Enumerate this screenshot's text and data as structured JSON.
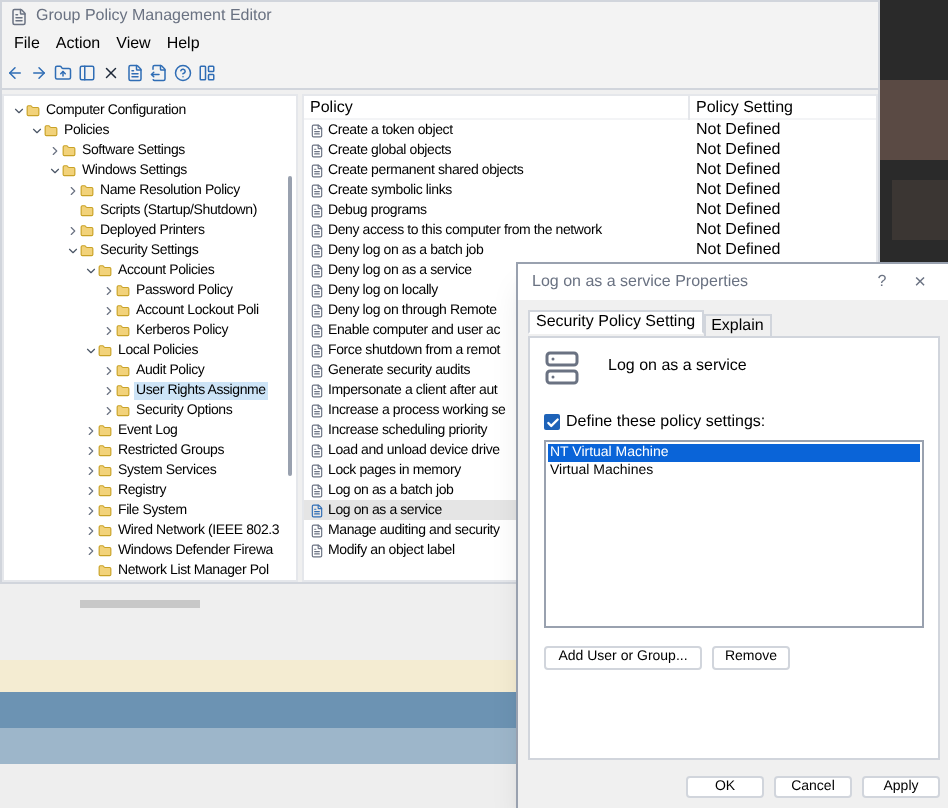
{
  "main_window": {
    "title": "Group Policy Management Editor",
    "menu": [
      "File",
      "Action",
      "View",
      "Help"
    ],
    "tree": [
      {
        "label": "Computer Configuration",
        "expanded": true,
        "selected": false,
        "children": [
          {
            "label": "Policies",
            "expanded": true,
            "selected": false,
            "children": [
              {
                "label": "Software Settings",
                "expanded": false,
                "selected": false
              },
              {
                "label": "Windows Settings",
                "expanded": true,
                "selected": false,
                "children": [
                  {
                    "label": "Name Resolution Policy",
                    "expanded": false,
                    "selected": false
                  },
                  {
                    "label": "Scripts (Startup/Shutdown)",
                    "selected": false
                  },
                  {
                    "label": "Deployed Printers",
                    "expanded": false,
                    "selected": false
                  },
                  {
                    "label": "Security Settings",
                    "expanded": true,
                    "selected": false,
                    "children": [
                      {
                        "label": "Account Policies",
                        "expanded": true,
                        "selected": false,
                        "children": [
                          {
                            "label": "Password Policy",
                            "expanded": false,
                            "selected": false
                          },
                          {
                            "label": "Account Lockout Poli",
                            "expanded": false,
                            "selected": false
                          },
                          {
                            "label": "Kerberos Policy",
                            "expanded": false,
                            "selected": false
                          }
                        ]
                      },
                      {
                        "label": "Local Policies",
                        "expanded": true,
                        "selected": false,
                        "children": [
                          {
                            "label": "Audit Policy",
                            "expanded": false,
                            "selected": false
                          },
                          {
                            "label": "User Rights Assignme",
                            "expanded": false,
                            "selected": true
                          },
                          {
                            "label": "Security Options",
                            "expanded": false,
                            "selected": false
                          }
                        ]
                      },
                      {
                        "label": "Event Log",
                        "expanded": false,
                        "selected": false
                      },
                      {
                        "label": "Restricted Groups",
                        "expanded": false,
                        "selected": false
                      },
                      {
                        "label": "System Services",
                        "expanded": false,
                        "selected": false
                      },
                      {
                        "label": "Registry",
                        "expanded": false,
                        "selected": false
                      },
                      {
                        "label": "File System",
                        "expanded": false,
                        "selected": false
                      },
                      {
                        "label": "Wired Network (IEEE 802.3",
                        "expanded": false,
                        "selected": false
                      },
                      {
                        "label": "Windows Defender Firewa",
                        "expanded": false,
                        "selected": false
                      },
                      {
                        "label": "Network List Manager Pol",
                        "selected": false
                      }
                    ]
                  }
                ]
              }
            ]
          }
        ]
      }
    ],
    "columns": [
      "Policy",
      "Policy Setting"
    ],
    "policies": [
      {
        "name": "Create a token object",
        "setting": "Not Defined",
        "selected": false
      },
      {
        "name": "Create global objects",
        "setting": "Not Defined",
        "selected": false
      },
      {
        "name": "Create permanent shared objects",
        "setting": "Not Defined",
        "selected": false
      },
      {
        "name": "Create symbolic links",
        "setting": "Not Defined",
        "selected": false
      },
      {
        "name": "Debug programs",
        "setting": "Not Defined",
        "selected": false
      },
      {
        "name": "Deny access to this computer from the network",
        "setting": "Not Defined",
        "selected": false
      },
      {
        "name": "Deny log on as a batch job",
        "setting": "Not Defined",
        "selected": false
      },
      {
        "name": "Deny log on as a service",
        "selected": false
      },
      {
        "name": "Deny log on locally",
        "selected": false
      },
      {
        "name": "Deny log on through Remote",
        "selected": false
      },
      {
        "name": "Enable computer and user ac",
        "selected": false
      },
      {
        "name": "Force shutdown from a remot",
        "selected": false
      },
      {
        "name": "Generate security audits",
        "selected": false
      },
      {
        "name": "Impersonate a client after aut",
        "selected": false
      },
      {
        "name": "Increase a process working se",
        "selected": false
      },
      {
        "name": "Increase scheduling priority",
        "selected": false
      },
      {
        "name": "Load and unload device drive",
        "selected": false
      },
      {
        "name": "Lock pages in memory",
        "selected": false
      },
      {
        "name": "Log on as a batch job",
        "selected": false
      },
      {
        "name": "Log on as a service",
        "selected": true
      },
      {
        "name": "Manage auditing and security",
        "selected": false
      },
      {
        "name": "Modify an object label",
        "selected": false
      }
    ]
  },
  "dialog": {
    "title": "Log on as a service Properties",
    "help": "?",
    "close": "×",
    "tabs": [
      {
        "label": "Security Policy Setting",
        "selected": true
      },
      {
        "label": "Explain",
        "selected": false
      }
    ],
    "policy_name": "Log on as a service",
    "define": {
      "label": "Define these policy settings:",
      "checked": true
    },
    "accounts": [
      {
        "name": "NT Virtual Machine",
        "selected": true
      },
      {
        "name": "Virtual Machines",
        "selected": false
      }
    ],
    "list_buttons": [
      "Add User or Group...",
      "Remove"
    ],
    "buttons": [
      "OK",
      "Cancel",
      "Apply"
    ]
  }
}
